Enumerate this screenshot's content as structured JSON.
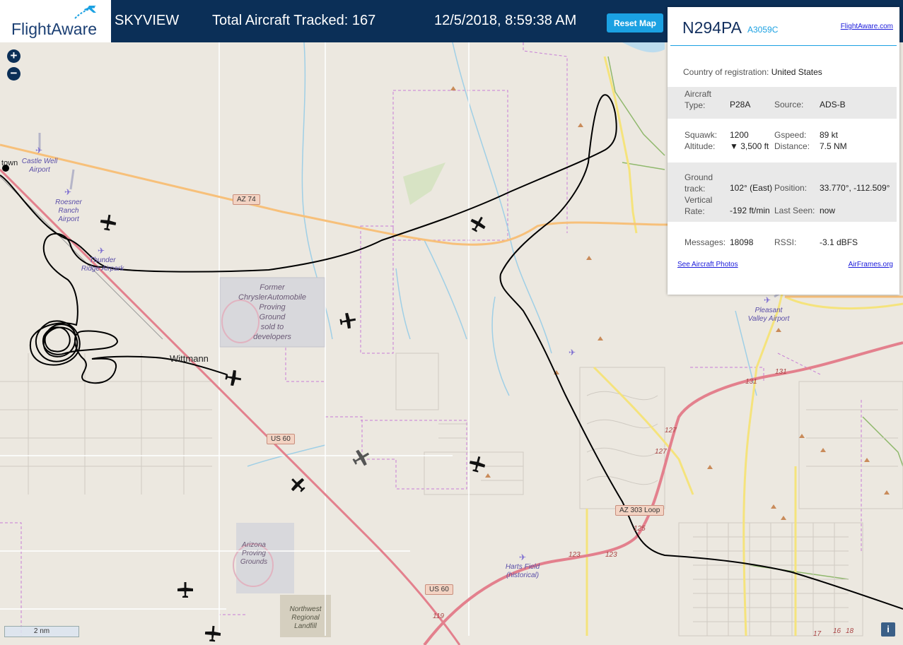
{
  "header": {
    "logo_text": "FlightAware",
    "app_name": "SKYVIEW",
    "aircraft_tracked": "Total Aircraft Tracked: 167",
    "datetime": "12/5/2018, 8:59:38 AM",
    "reset_button": "Reset Map"
  },
  "map": {
    "zoom_in": "+",
    "zoom_out": "−",
    "scale_label": "2 nm",
    "info_label": "i",
    "towns": [
      "Wittmann",
      "town"
    ],
    "places": {
      "chrysler": [
        "Former",
        "ChryslerAutomobile",
        "Proving",
        "Ground",
        "sold to",
        "developers"
      ],
      "arizona_pg": [
        "Arizona",
        "Proving",
        "Grounds"
      ],
      "landfill": [
        "Northwest",
        "Regional",
        "Landfill"
      ]
    },
    "airports": {
      "castle_well": [
        "Castle Well",
        "Airport"
      ],
      "roesner": [
        "Roesner",
        "Ranch",
        "Airport"
      ],
      "thunder_ridge": [
        "Thunder",
        "Ridge Airpark"
      ],
      "pleasant_valley": [
        "Pleasant",
        "Valley Airport"
      ],
      "harts_field": [
        "Harts Field",
        "(historical)"
      ]
    },
    "road_shields": {
      "az74": "AZ 74",
      "us60_a": "US 60",
      "us60_b": "US 60",
      "az303": "AZ 303 Loop"
    },
    "exit_numbers": [
      "131",
      "131",
      "127",
      "127",
      "125",
      "123",
      "123",
      "119",
      "17",
      "16",
      "18"
    ],
    "colors": {
      "track": "#000000",
      "motorway": "#e3808d",
      "trunk": "#f7c07a",
      "highway_secondary": "#f5e37c",
      "boundary": "#c77dd6",
      "water": "#9fcfe6",
      "park": "#8fb86c",
      "restricted": "#e1b3c0"
    }
  },
  "panel": {
    "tail": "N294PA",
    "hex": "A3059C",
    "site_link": "FlightAware.com",
    "country_label": "Country of registration:",
    "country_value": "United States",
    "aircraft_type_label": [
      "Aircraft",
      "Type:"
    ],
    "aircraft_type_value": "P28A",
    "source_label": "Source:",
    "source_value": "ADS-B",
    "squawk_label": "Squawk:",
    "squawk_value": "1200",
    "altitude_label": "Altitude:",
    "altitude_value": "▼ 3,500 ft",
    "gspeed_label": "Gspeed:",
    "gspeed_value": "89 kt",
    "distance_label": "Distance:",
    "distance_value": "7.5 NM",
    "ground_track_label": [
      "Ground",
      "track:"
    ],
    "ground_track_value": "102° (East)",
    "position_label": "Position:",
    "position_value": "33.770°, -112.509°",
    "vertical_rate_label": [
      "Vertical",
      "Rate:"
    ],
    "vertical_rate_value": "-192 ft/min",
    "last_seen_label": "Last Seen:",
    "last_seen_value": "now",
    "messages_label": "Messages:",
    "messages_value": "18098",
    "rssi_label": "RSSI:",
    "rssi_value": "-3.1 dBFS",
    "photos_link": "See Aircraft Photos",
    "airframes_link": "AirFrames.org"
  }
}
